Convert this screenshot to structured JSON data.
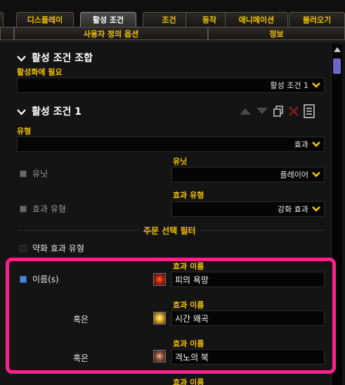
{
  "tabs": {
    "row1": [
      "디스플레이",
      "활성 조건",
      "조건",
      "동작",
      "애니메이션",
      "불러오기"
    ],
    "active": "활성 조건",
    "row2": [
      "사용자 정의 옵션",
      "정보"
    ]
  },
  "combo_section": {
    "title": "활성 조건 조합",
    "required_label": "활성화에 필요",
    "required_value": "활성 조건 1"
  },
  "condition1": {
    "title": "활성 조건 1",
    "type_label": "유형",
    "type_value": "효과",
    "unit_check_label": "유닛",
    "unit_label": "유닛",
    "unit_value": "플레이어",
    "effect_type_check_label": "효과 유형",
    "effect_type_label": "효과 유형",
    "effect_type_value": "강화 효과"
  },
  "spell_filter": {
    "title": "주문 선택 필터",
    "weak_effect_label": "약화 효과 유형",
    "names_label": "이름(s)",
    "field_label": "효과 이름",
    "or_label": "혹은",
    "entries": [
      {
        "name": "피의 욕망",
        "icon": "bloodlust-icon"
      },
      {
        "name": "시간 왜곡",
        "icon": "time-warp-icon"
      },
      {
        "name": "격노의 북",
        "icon": "drums-of-fury-icon"
      }
    ],
    "next_field_label": "효과 이름"
  },
  "colors": {
    "accent_yellow": "#f5c400",
    "highlight_pink": "#ff1f8e",
    "scroll_thumb": "#6b68c8"
  }
}
